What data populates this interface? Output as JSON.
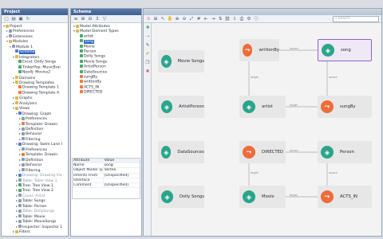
{
  "project_panel": {
    "title": "Project",
    "tree": [
      {
        "label": "Project",
        "icon": "folder",
        "depth": 0,
        "toggle": "▾"
      },
      {
        "label": "Preferences",
        "icon": "gear",
        "depth": 1,
        "toggle": "▸"
      },
      {
        "label": "Extensions",
        "icon": "item",
        "depth": 1,
        "toggle": "▸"
      },
      {
        "label": "Modules",
        "icon": "folder",
        "depth": 1,
        "toggle": "▾"
      },
      {
        "label": "Module 1",
        "icon": "item",
        "depth": 2,
        "toggle": "▾"
      },
      {
        "label": "Schema",
        "icon": "blue",
        "depth": 3,
        "toggle": "",
        "selected": true
      },
      {
        "label": "Integrators",
        "icon": "folder",
        "depth": 3,
        "toggle": "▾"
      },
      {
        "label": "Excel: Dolly Songs",
        "icon": "green",
        "depth": 4,
        "toggle": ""
      },
      {
        "label": "TinkerPop: MusicBrai",
        "icon": "green",
        "depth": 4,
        "toggle": ""
      },
      {
        "label": "Neo4j: Movies2",
        "icon": "green",
        "depth": 4,
        "toggle": ""
      },
      {
        "label": "Domains",
        "icon": "folder",
        "depth": 3,
        "toggle": "▸"
      },
      {
        "label": "Drawing Templates",
        "icon": "folder",
        "depth": 3,
        "toggle": "▾"
      },
      {
        "label": "Drawing Template 1",
        "icon": "orange",
        "depth": 4,
        "toggle": ""
      },
      {
        "label": "Drawing Template A",
        "icon": "orange",
        "depth": 4,
        "toggle": ""
      },
      {
        "label": "Graphs",
        "icon": "folder",
        "depth": 3,
        "toggle": "▸"
      },
      {
        "label": "Analyzers",
        "icon": "folder",
        "depth": 3,
        "toggle": "▸"
      },
      {
        "label": "Views",
        "icon": "folder",
        "depth": 3,
        "toggle": "▾"
      },
      {
        "label": "Drawing: Graph",
        "icon": "blue",
        "depth": 4,
        "toggle": "▾"
      },
      {
        "label": "Preferences",
        "icon": "gear",
        "depth": 5,
        "toggle": "▸"
      },
      {
        "label": "Template: Drawin",
        "icon": "orange",
        "depth": 5,
        "toggle": "▸"
      },
      {
        "label": "Definition",
        "icon": "item",
        "depth": 5,
        "toggle": "▸"
      },
      {
        "label": "Behavior",
        "icon": "item",
        "depth": 5,
        "toggle": "▸"
      },
      {
        "label": "Filtering",
        "icon": "item",
        "depth": 5,
        "toggle": "▸"
      },
      {
        "label": "Drawing: Swim Lane I",
        "icon": "blue",
        "depth": 4,
        "toggle": "▾"
      },
      {
        "label": "Preferences",
        "icon": "gear",
        "depth": 5,
        "toggle": "▸"
      },
      {
        "label": "Template: Drawin",
        "icon": "orange",
        "depth": 5,
        "toggle": "▸"
      },
      {
        "label": "Definition",
        "icon": "item",
        "depth": 5,
        "toggle": "▸"
      },
      {
        "label": "Behavior",
        "icon": "item",
        "depth": 5,
        "toggle": "▸"
      },
      {
        "label": "Filtering",
        "icon": "item",
        "depth": 5,
        "toggle": "▸"
      },
      {
        "label": "Drawing: Drawing Vie",
        "icon": "blue",
        "depth": 4,
        "toggle": "▸",
        "dim": true
      },
      {
        "label": "Table: Table View 1",
        "icon": "item",
        "depth": 4,
        "toggle": "▸",
        "dim": true
      },
      {
        "label": "Tree: Tree View 1",
        "icon": "green",
        "depth": 4,
        "toggle": "▸"
      },
      {
        "label": "Tree: Tree View 2",
        "icon": "green",
        "depth": 4,
        "toggle": "▸"
      },
      {
        "label": "Cover: Artist",
        "icon": "item",
        "depth": 4,
        "toggle": "▸",
        "dim": true
      },
      {
        "label": "Table: Songs",
        "icon": "item",
        "depth": 4,
        "toggle": "▸"
      },
      {
        "label": "Table: Person",
        "icon": "item",
        "depth": 4,
        "toggle": "▸"
      },
      {
        "label": "Table: DollySongs",
        "icon": "item",
        "depth": 4,
        "toggle": "▸",
        "dim": true
      },
      {
        "label": "Table: Movie",
        "icon": "item",
        "depth": 4,
        "toggle": "▸"
      },
      {
        "label": "Table: MovieSongs",
        "icon": "item",
        "depth": 4,
        "toggle": "▸"
      },
      {
        "label": "Inspector: Inspector 1",
        "icon": "item",
        "depth": 4,
        "toggle": "▸"
      },
      {
        "label": "Filters",
        "icon": "folder",
        "depth": 3,
        "toggle": "▸"
      }
    ]
  },
  "schema_panel": {
    "title": "Schema",
    "tree": [
      {
        "label": "Model Attributes",
        "icon": "folder",
        "depth": 0,
        "toggle": "▸"
      },
      {
        "label": "Model Element Types",
        "icon": "folder",
        "depth": 0,
        "toggle": "▾"
      },
      {
        "label": "artist",
        "icon": "green",
        "depth": 1,
        "toggle": ""
      },
      {
        "label": "song",
        "icon": "green",
        "depth": 1,
        "toggle": "",
        "selected": true
      },
      {
        "label": "Movie",
        "icon": "green",
        "depth": 1,
        "toggle": ""
      },
      {
        "label": "Person",
        "icon": "green",
        "depth": 1,
        "toggle": ""
      },
      {
        "label": "Dolly Songs",
        "icon": "green",
        "depth": 1,
        "toggle": ""
      },
      {
        "label": "Movie Songs",
        "icon": "green",
        "depth": 1,
        "toggle": ""
      },
      {
        "label": "ArtistPerson",
        "icon": "green",
        "depth": 1,
        "toggle": ""
      },
      {
        "label": "DataSources",
        "icon": "green",
        "depth": 1,
        "toggle": ""
      },
      {
        "label": "sungBy",
        "icon": "orange",
        "depth": 1,
        "toggle": ""
      },
      {
        "label": "writtenBy",
        "icon": "orange",
        "depth": 1,
        "toggle": ""
      },
      {
        "label": "ACTS_IN",
        "icon": "orange",
        "depth": 1,
        "toggle": ""
      },
      {
        "label": "DIRECTED",
        "icon": "orange",
        "depth": 1,
        "toggle": ""
      }
    ],
    "properties": {
      "header": {
        "attribute": "Attribute",
        "value": "Value"
      },
      "rows": [
        {
          "attribute": "Name",
          "value": "song"
        },
        {
          "attribute": "Object Model Type",
          "value": "Vertex"
        },
        {
          "attribute": "Inherits From",
          "value": "[Unspecified]"
        },
        {
          "attribute": "Interface",
          "value": ""
        },
        {
          "attribute": "Comment",
          "value": "[Unspecified]"
        }
      ]
    }
  },
  "diagram": {
    "search_placeholder": "Search",
    "nodes": [
      {
        "id": "movie_songs",
        "label": "Movie Songs",
        "kind": "vertex"
      },
      {
        "id": "writtenBy",
        "label": "writtenBy",
        "kind": "edge"
      },
      {
        "id": "song",
        "label": "song",
        "kind": "vertex",
        "selected": true
      },
      {
        "id": "artist_person",
        "label": "ArtistPerson",
        "kind": "vertex"
      },
      {
        "id": "artist",
        "label": "artist",
        "kind": "vertex"
      },
      {
        "id": "sungBy",
        "label": "sungBy",
        "kind": "edge"
      },
      {
        "id": "datasources",
        "label": "DataSources",
        "kind": "vertex"
      },
      {
        "id": "directed",
        "label": "DIRECTED",
        "kind": "edge"
      },
      {
        "id": "person",
        "label": "Person",
        "kind": "vertex"
      },
      {
        "id": "dolly_songs",
        "label": "Dolly Songs",
        "kind": "vertex"
      },
      {
        "id": "movie",
        "label": "Movie",
        "kind": "vertex"
      },
      {
        "id": "acts_in",
        "label": "ACTS_IN",
        "kind": "edge"
      }
    ],
    "edge_labels": {
      "writtenBy_song": "source",
      "writtenBy_artist": "target",
      "song_sungBy": "source",
      "artist_sungBy": "target",
      "directed_person": "source",
      "directed_movie": "target",
      "movie_acts_in": "target",
      "acts_in_person": "source"
    }
  },
  "colors": {
    "vertex_badge": "#2aa58a",
    "edge_badge": "#ee6b3a",
    "selection": "#2f65c7",
    "panel_title": "#4b6c9e"
  }
}
